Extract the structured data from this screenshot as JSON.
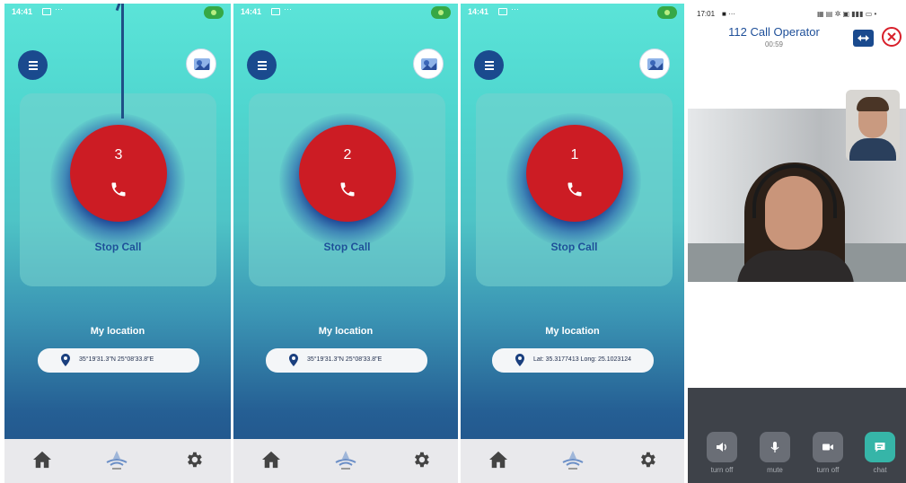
{
  "screens": [
    {
      "status_time": "14:41",
      "status_dots": "···",
      "countdown": "3",
      "stop_label": "Stop Call",
      "location_title": "My location",
      "location_value": "35°19'31.3\"N 25°08'33.8\"E"
    },
    {
      "status_time": "14:41",
      "status_dots": "···",
      "countdown": "2",
      "stop_label": "Stop Call",
      "location_title": "My location",
      "location_value": "35°19'31.3\"N 25°08'33.8\"E"
    },
    {
      "status_time": "14:41",
      "status_dots": "···",
      "countdown": "1",
      "stop_label": "Stop Call",
      "location_title": "My location",
      "location_value": "Lat: 35.3177413 Long: 25.1023124"
    }
  ],
  "video_call": {
    "status_time": "17:01",
    "status_icons": "■ ···",
    "title": "112 Call Operator",
    "timer": "00:59",
    "controls": [
      {
        "label": "turn off",
        "icon": "speaker-icon"
      },
      {
        "label": "mute",
        "icon": "microphone-icon"
      },
      {
        "label": "turn off",
        "icon": "video-camera-icon"
      },
      {
        "label": "chat",
        "icon": "chat-icon"
      }
    ]
  },
  "colors": {
    "accent": "#1a4a8e",
    "call_red": "#cc1c24",
    "chat_teal": "#36b5a8",
    "close_red": "#d81f2a"
  }
}
